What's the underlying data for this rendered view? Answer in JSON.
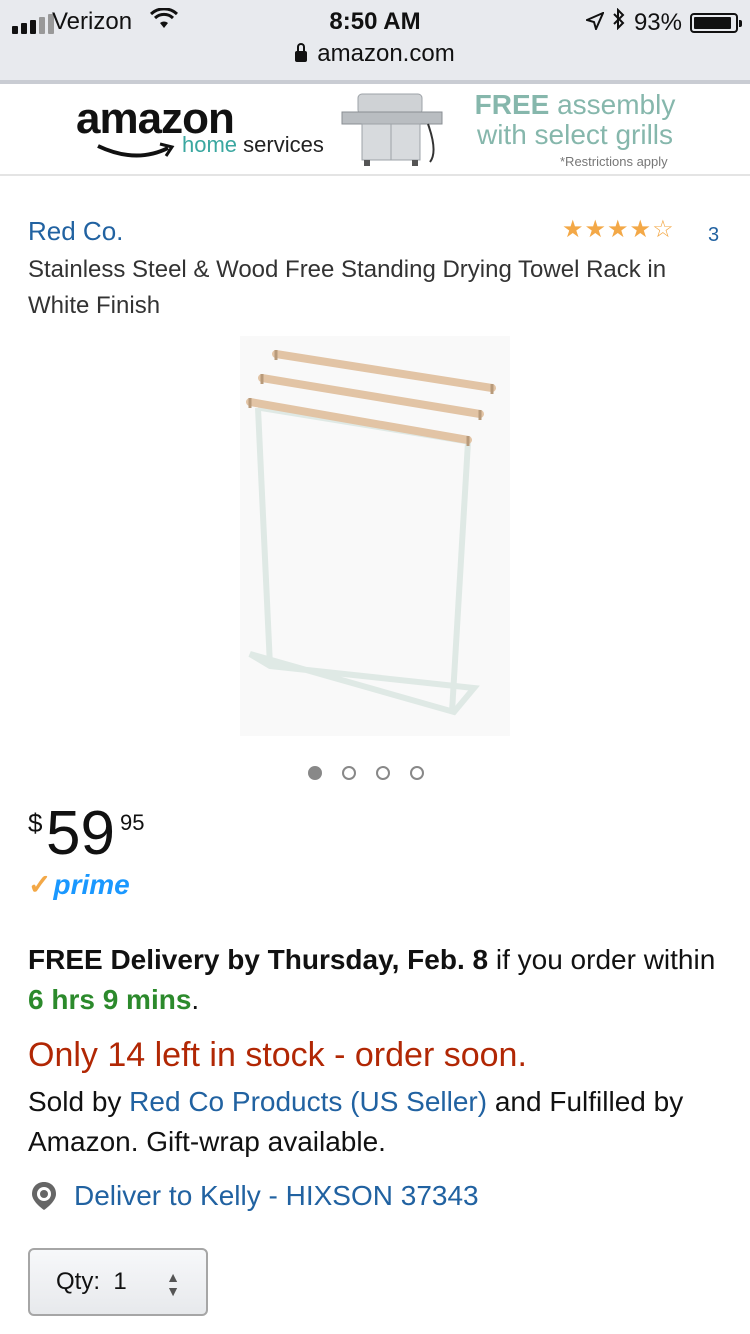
{
  "status_bar": {
    "carrier": "Verizon",
    "time": "8:50 AM",
    "battery": "93%",
    "battery_level": 0.93,
    "url": "amazon.com"
  },
  "banner": {
    "logo_text": "amazon",
    "logo_sub_home": "home",
    "logo_sub_services": " services",
    "promo_free": "FREE",
    "promo_line1_rest": " assembly",
    "promo_line2": "with select grills",
    "restrictions": "*Restrictions apply"
  },
  "product": {
    "brand": "Red Co.",
    "rating": 4,
    "rating_max": 5,
    "review_count": "3",
    "title": "Stainless Steel & Wood Free Standing Drying Towel Rack in White Finish",
    "image_count": 4,
    "image_index": 0
  },
  "price": {
    "currency": "$",
    "whole": "59",
    "fraction": "95",
    "prime_label": "prime"
  },
  "delivery": {
    "bold": "FREE Delivery by Thursday, Feb. 8",
    "middle": " if you order within ",
    "countdown": "6 hrs 9 mins",
    "end": "."
  },
  "stock": {
    "message": "Only 14 left in stock - order soon."
  },
  "seller": {
    "prefix": "Sold by ",
    "name": "Red Co Products (US Seller)",
    "suffix": " and Fulfilled by Amazon. Gift-wrap available."
  },
  "deliver_to": {
    "text": "Deliver to Kelly - HIXSON 37343"
  },
  "quantity": {
    "label": "Qty:",
    "value": "1"
  },
  "colors": {
    "link": "#2162a1",
    "stock_red": "#b12704",
    "countdown_green": "#2c8a2c",
    "star": "#f3a847",
    "prime_blue": "#1a98ff"
  }
}
